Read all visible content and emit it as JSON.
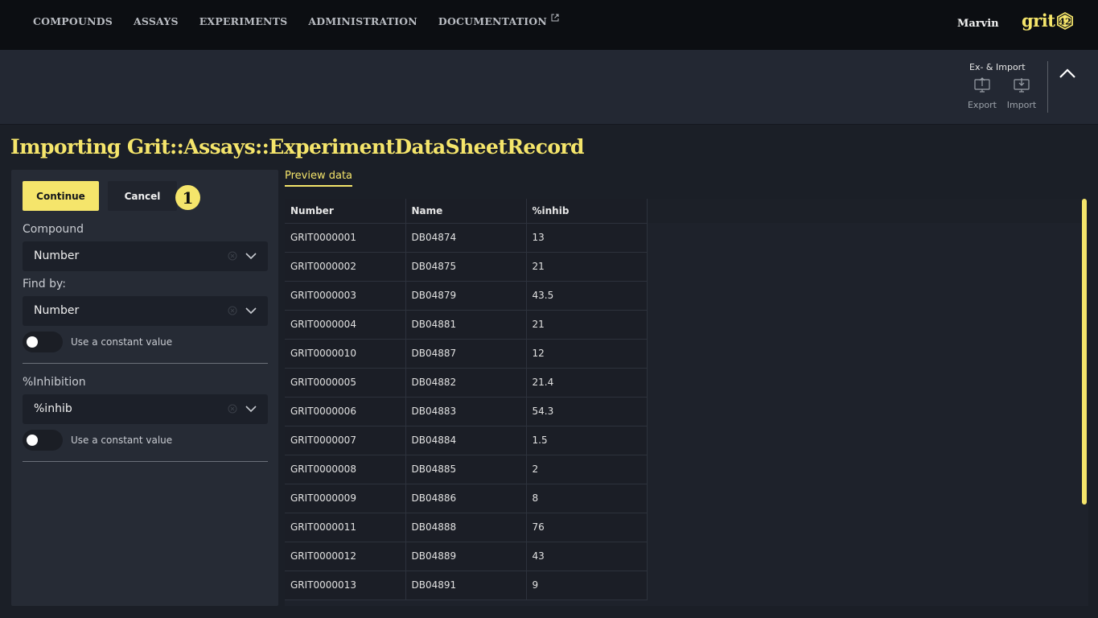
{
  "nav": {
    "items": [
      "COMPOUNDS",
      "ASSAYS",
      "EXPERIMENTS",
      "ADMINISTRATION",
      "DOCUMENTATION"
    ]
  },
  "user": {
    "name": "Marvin"
  },
  "logo": {
    "text": "grit",
    "badge": "42"
  },
  "toolbar": {
    "group_title": "Ex- & Import",
    "export_label": "Export",
    "import_label": "Import"
  },
  "page": {
    "title": "Importing Grit::Assays::ExperimentDataSheetRecord"
  },
  "form": {
    "continue_label": "Continue",
    "cancel_label": "Cancel",
    "step_badge": "1",
    "compound_label": "Compound",
    "compound_value": "Number",
    "find_by_label": "Find by:",
    "find_by_value": "Number",
    "constant_label_1": "Use a constant value",
    "inhibition_label": "%Inhibition",
    "inhibition_value": "%inhib",
    "constant_label_2": "Use a constant value"
  },
  "preview": {
    "tab_label": "Preview data",
    "columns": [
      "Number",
      "Name",
      "%inhib"
    ],
    "rows": [
      [
        "GRIT0000001",
        "DB04874",
        "13"
      ],
      [
        "GRIT0000002",
        "DB04875",
        "21"
      ],
      [
        "GRIT0000003",
        "DB04879",
        "43.5"
      ],
      [
        "GRIT0000004",
        "DB04881",
        "21"
      ],
      [
        "GRIT0000010",
        "DB04887",
        "12"
      ],
      [
        "GRIT0000005",
        "DB04882",
        "21.4"
      ],
      [
        "GRIT0000006",
        "DB04883",
        "54.3"
      ],
      [
        "GRIT0000007",
        "DB04884",
        "1.5"
      ],
      [
        "GRIT0000008",
        "DB04885",
        "2"
      ],
      [
        "GRIT0000009",
        "DB04886",
        "8"
      ],
      [
        "GRIT0000011",
        "DB04888",
        "76"
      ],
      [
        "GRIT0000012",
        "DB04889",
        "43"
      ],
      [
        "GRIT0000013",
        "DB04891",
        "9"
      ]
    ]
  },
  "colors": {
    "accent": "#f5e56b",
    "background": "#1b1f27",
    "topbar": "#0c0e12"
  },
  "icons": {
    "external_link": "external-link-icon",
    "export": "upload-monitor-icon",
    "import": "download-monitor-icon",
    "collapse": "chevron-up-icon",
    "clear": "clear-circle-icon",
    "dropdown": "chevron-down-icon"
  }
}
